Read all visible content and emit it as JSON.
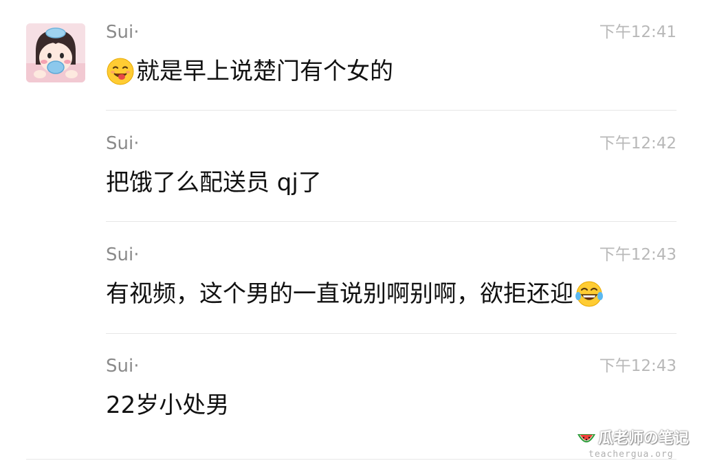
{
  "messages": [
    {
      "sender": "Sui·",
      "time": "下午12:41",
      "text": "就是早上说楚门有个女的",
      "emoji_before": "yum-face-emoji"
    },
    {
      "sender": "Sui·",
      "time": "下午12:42",
      "text": "把饿了么配送员 qj了"
    },
    {
      "sender": "Sui·",
      "time": "下午12:43",
      "text": "有视频，这个男的一直说别啊别啊，欲拒还迎",
      "emoji_after": "tears-of-joy-emoji"
    },
    {
      "sender": "Sui·",
      "time": "下午12:43",
      "text": "22岁小处男"
    }
  ],
  "watermark": {
    "title": "瓜老师の笔记",
    "url": "teachergua.org",
    "icon": "watermelon-icon"
  },
  "colors": {
    "sender": "#8a8a8a",
    "time": "#b8b8b8",
    "text": "#111111",
    "divider": "#e6e6e6"
  }
}
